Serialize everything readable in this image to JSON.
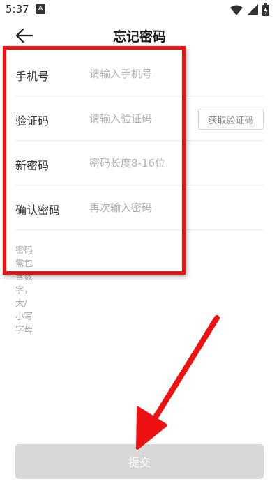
{
  "status_bar": {
    "time": "5:37",
    "notification_glyph": "A",
    "icons": [
      "wifi-icon",
      "signal-icon",
      "battery-charging-icon"
    ]
  },
  "header": {
    "back_icon": "arrow-left-icon",
    "title": "忘记密码"
  },
  "form": {
    "phone": {
      "label": "手机号",
      "placeholder": "请输入手机号",
      "value": ""
    },
    "code": {
      "label": "验证码",
      "placeholder": "请输入验证码",
      "value": "",
      "button_label": "获取验证码"
    },
    "new_password": {
      "label": "新密码",
      "placeholder": "密码长度8-16位",
      "value": ""
    },
    "confirm_password": {
      "label": "确认密码",
      "placeholder": "再次输入密码",
      "value": ""
    },
    "hint": "密码需包含数字，大/小写字母"
  },
  "submit": {
    "label": "提交"
  },
  "colors": {
    "annotation_red": "#ee1111",
    "submit_disabled_bg": "#d8d8d8",
    "placeholder": "#b2b2b2"
  }
}
